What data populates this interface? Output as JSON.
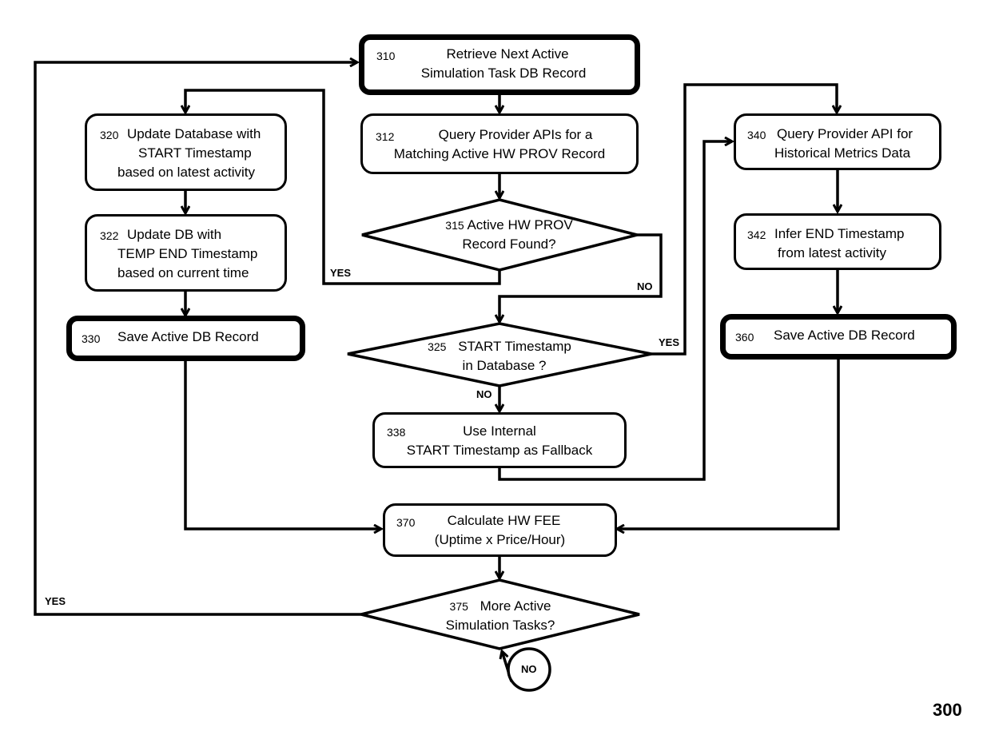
{
  "figure_number": "300",
  "nodes": {
    "n310": {
      "id": "310",
      "lines": [
        "Retrieve Next Active",
        "Simulation Task DB Record"
      ],
      "shape": "process-bold"
    },
    "n312": {
      "id": "312",
      "lines": [
        "Query Provider APIs for a",
        "Matching Active HW PROV Record"
      ],
      "shape": "process"
    },
    "n315": {
      "id": "315",
      "lines": [
        "Active HW PROV",
        "Record Found?"
      ],
      "shape": "decision"
    },
    "n320": {
      "id": "320",
      "lines": [
        "Update Database with",
        "START Timestamp",
        "based on latest activity"
      ],
      "shape": "process"
    },
    "n322": {
      "id": "322",
      "lines": [
        "Update DB with",
        "TEMP END Timestamp",
        "based on current time"
      ],
      "shape": "process"
    },
    "n325": {
      "id": "325",
      "lines": [
        "START Timestamp",
        "in Database ?"
      ],
      "shape": "decision"
    },
    "n330": {
      "id": "330",
      "lines": [
        "Save Active DB Record"
      ],
      "shape": "process-bold"
    },
    "n338": {
      "id": "338",
      "lines": [
        "Use Internal",
        "START Timestamp as Fallback"
      ],
      "shape": "process"
    },
    "n340": {
      "id": "340",
      "lines": [
        "Query Provider API for",
        "Historical Metrics Data"
      ],
      "shape": "process"
    },
    "n342": {
      "id": "342",
      "lines": [
        "Infer END Timestamp",
        "from latest activity"
      ],
      "shape": "process"
    },
    "n360": {
      "id": "360",
      "lines": [
        "Save Active DB Record"
      ],
      "shape": "process-bold"
    },
    "n370": {
      "id": "370",
      "lines": [
        "Calculate HW FEE",
        "(Uptime x Price/Hour)"
      ],
      "shape": "process"
    },
    "n375": {
      "id": "375",
      "lines": [
        "More Active",
        "Simulation Tasks?"
      ],
      "shape": "decision"
    },
    "end": {
      "label": "NO",
      "shape": "terminator-circle"
    }
  },
  "edge_labels": {
    "e315_yes": "YES",
    "e315_no": "NO",
    "e325_yes": "YES",
    "e325_no": "NO",
    "e375_yes": "YES"
  },
  "edges": [
    {
      "from": "310",
      "to": "312"
    },
    {
      "from": "312",
      "to": "315"
    },
    {
      "from": "315",
      "to": "320",
      "label": "YES"
    },
    {
      "from": "315",
      "to": "325",
      "label": "NO"
    },
    {
      "from": "320",
      "to": "322"
    },
    {
      "from": "322",
      "to": "330"
    },
    {
      "from": "325",
      "to": "340",
      "label": "YES"
    },
    {
      "from": "325",
      "to": "338",
      "label": "NO"
    },
    {
      "from": "338",
      "to": "340"
    },
    {
      "from": "340",
      "to": "342"
    },
    {
      "from": "342",
      "to": "360"
    },
    {
      "from": "330",
      "to": "370"
    },
    {
      "from": "360",
      "to": "370"
    },
    {
      "from": "370",
      "to": "375"
    },
    {
      "from": "375",
      "to": "310",
      "label": "YES"
    },
    {
      "from": "375",
      "to": "end",
      "label": "NO"
    }
  ]
}
